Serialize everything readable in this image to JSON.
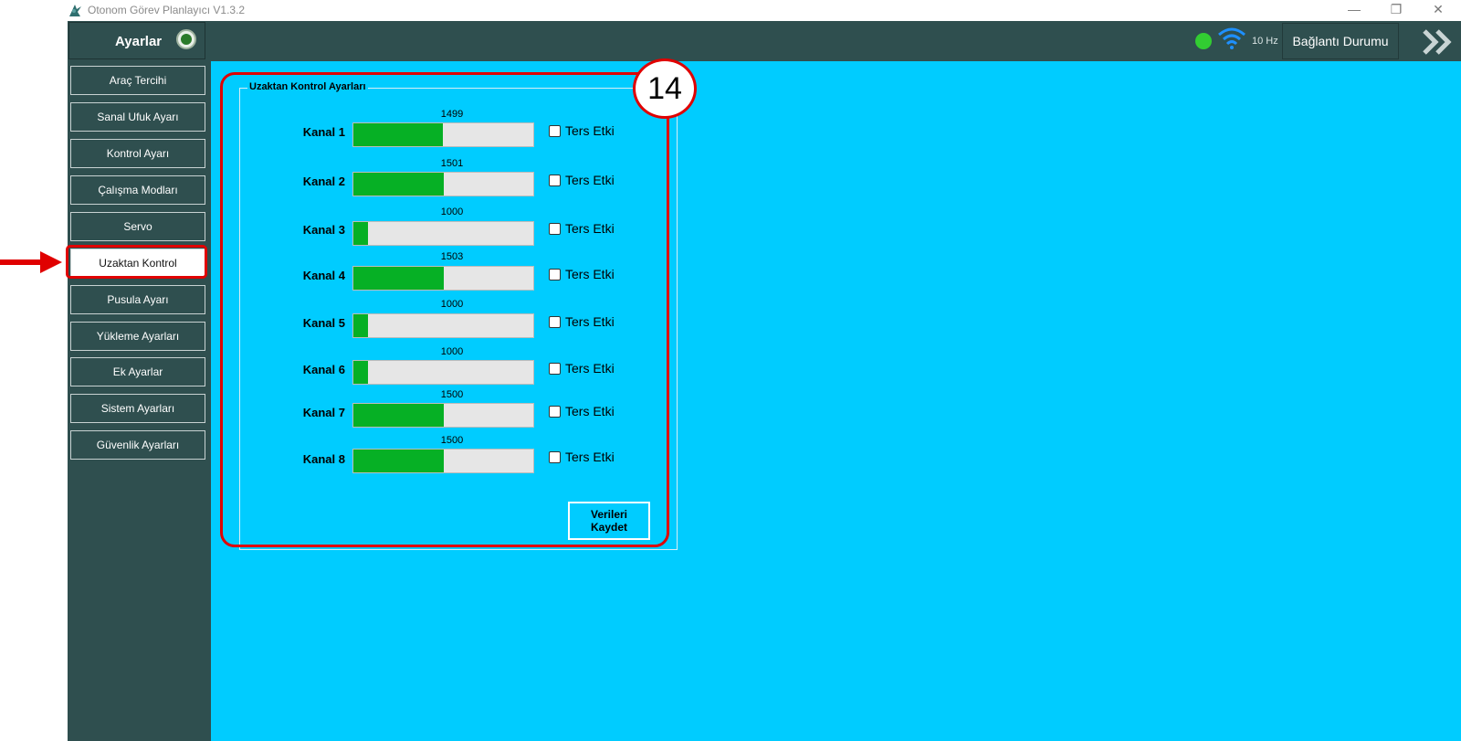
{
  "window": {
    "title": "Otonom Görev Planlayıcı V1.3.2",
    "controls": {
      "minimize": "—",
      "restore": "❐",
      "close": "✕"
    }
  },
  "header": {
    "settings_title": "Ayarlar",
    "frequency": "10 Hz",
    "connection_button": "Bağlantı Durumu",
    "status_color": "#32cd32"
  },
  "sidebar": {
    "items": [
      {
        "label": "Araç Tercihi"
      },
      {
        "label": "Sanal Ufuk Ayarı"
      },
      {
        "label": "Kontrol Ayarı"
      },
      {
        "label": "Çalışma Modları"
      },
      {
        "label": "Servo"
      },
      {
        "label": "Uzaktan Kontrol",
        "active": true
      },
      {
        "label": "Pusula Ayarı"
      },
      {
        "label": "Yükleme Ayarları"
      },
      {
        "label": "Ek Ayarlar"
      },
      {
        "label": "Sistem Ayarları"
      },
      {
        "label": "Güvenlik Ayarları"
      }
    ]
  },
  "remote_control": {
    "group_title": "Uzaktan Kontrol Ayarları",
    "callout": "14",
    "channels": [
      {
        "label": "Kanal 1",
        "value": "1499",
        "level": 0.499,
        "checkbox_label": "Ters Etki",
        "checked": false
      },
      {
        "label": "Kanal 2",
        "value": "1501",
        "level": 0.501,
        "checkbox_label": "Ters Etki",
        "checked": false
      },
      {
        "label": "Kanal 3",
        "value": "1000",
        "level": 0.0,
        "checkbox_label": "Ters Etki",
        "checked": false
      },
      {
        "label": "Kanal 4",
        "value": "1503",
        "level": 0.503,
        "checkbox_label": "Ters Etki",
        "checked": false
      },
      {
        "label": "Kanal 5",
        "value": "1000",
        "level": 0.0,
        "checkbox_label": "Ters Etki",
        "checked": false
      },
      {
        "label": "Kanal 6",
        "value": "1000",
        "level": 0.0,
        "checkbox_label": "Ters Etki",
        "checked": false
      },
      {
        "label": "Kanal 7",
        "value": "1500",
        "level": 0.5,
        "checkbox_label": "Ters Etki",
        "checked": false
      },
      {
        "label": "Kanal 8",
        "value": "1500",
        "level": 0.5,
        "checkbox_label": "Ters Etki",
        "checked": false
      }
    ],
    "save_button": "Verileri Kaydet"
  },
  "colors": {
    "header_bg": "#2f4f4f",
    "main_bg": "#00ccff",
    "bar_fill": "#06b025",
    "highlight": "#e00000"
  }
}
